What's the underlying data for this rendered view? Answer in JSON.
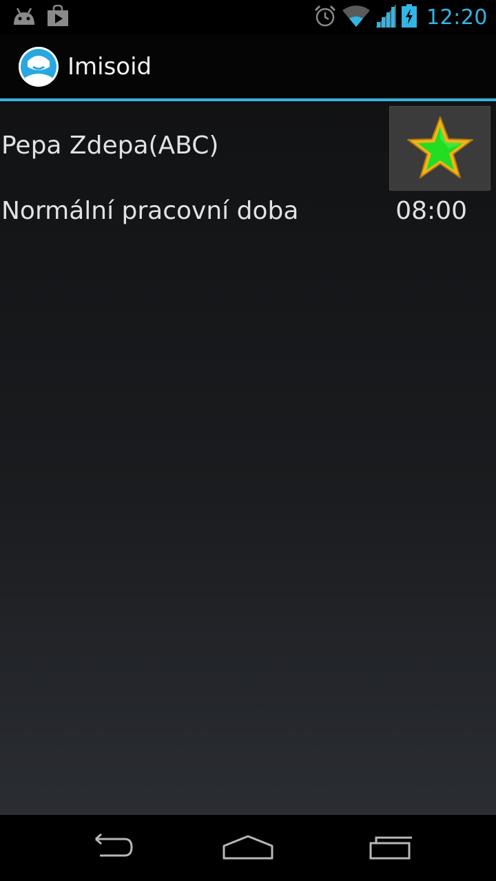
{
  "status_bar": {
    "left_icons": [
      "android-debug-icon",
      "play-store-icon"
    ],
    "right_icons": [
      "alarm-icon",
      "wifi-icon",
      "signal-icon",
      "battery-charging-icon"
    ],
    "time": "12:20"
  },
  "action_bar": {
    "app_icon": "imisoid-app-icon",
    "title": "Imisoid"
  },
  "content": {
    "employee_name": "Pepa Zdepa(ABC)",
    "favorite_icon": "star-icon",
    "work_type_label": "Normální pracovní doba",
    "work_hours_value": "08:00"
  },
  "nav_bar": {
    "buttons": [
      "back-icon",
      "home-icon",
      "recent-apps-icon"
    ]
  },
  "colors": {
    "accent": "#33b5e5",
    "star_fill": "#22dd22",
    "star_border": "#f2b31c"
  }
}
